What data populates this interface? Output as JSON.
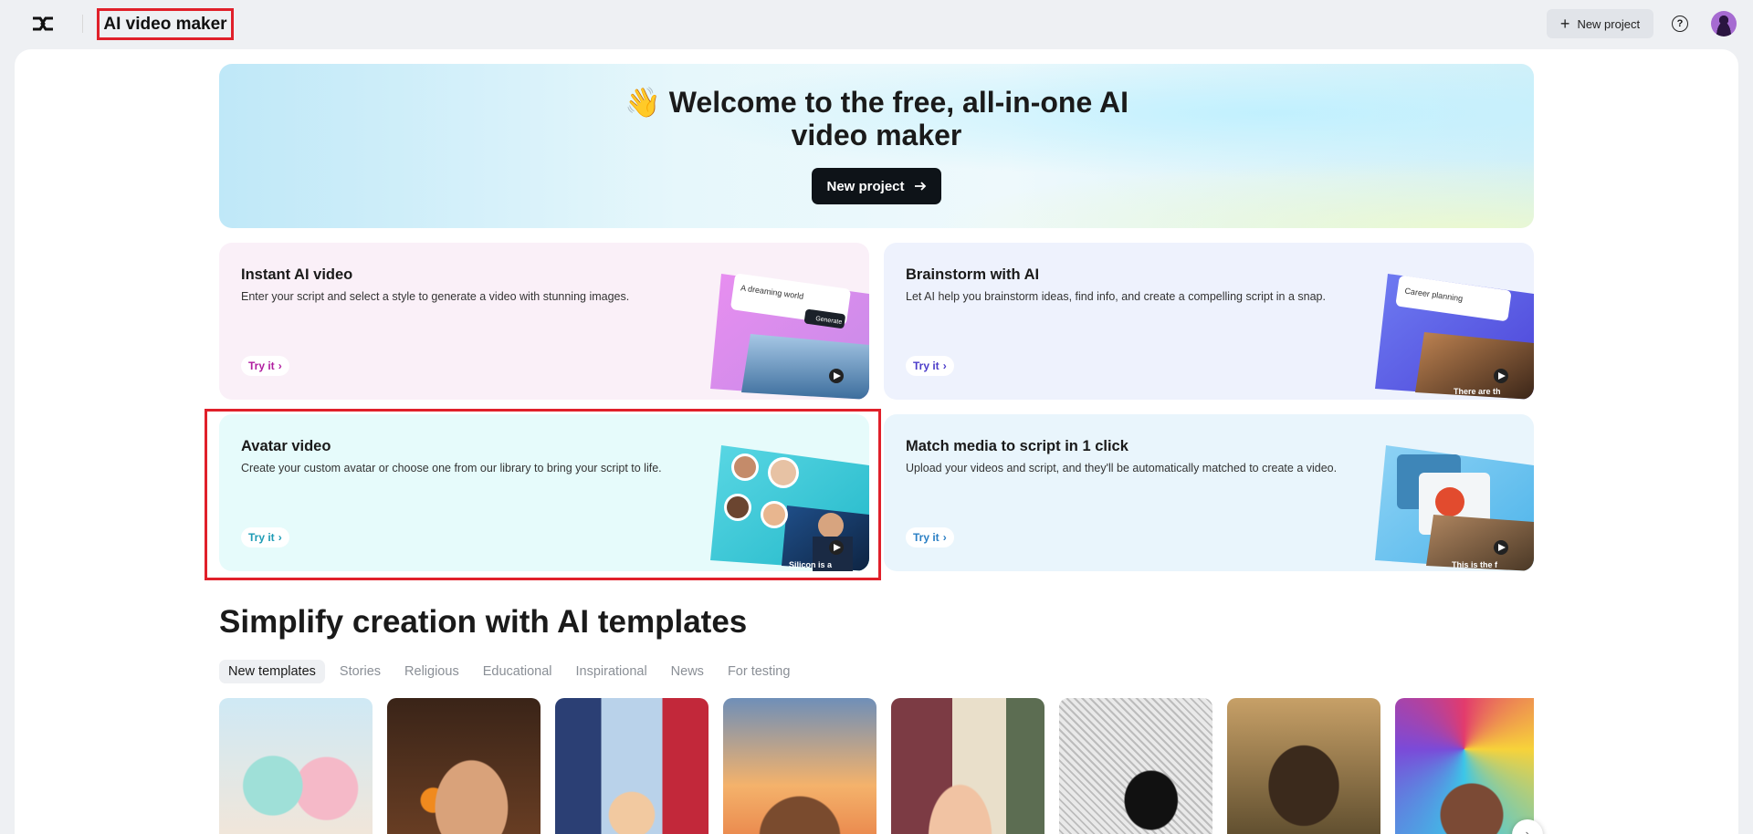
{
  "topbar": {
    "app_title": "AI video maker",
    "new_project_label": "New project",
    "help_icon": "?"
  },
  "hero": {
    "title_line1": "👋 Welcome to the free, all-in-one AI",
    "title_line2": "video maker",
    "button_label": "New project"
  },
  "cards": [
    {
      "title": "Instant AI video",
      "description": "Enter your script and select a style to generate a video with stunning images.",
      "try_label": "Try it",
      "art_prompt": "A dreaming world",
      "art_button": "Generate"
    },
    {
      "title": "Brainstorm with AI",
      "description": "Let AI help you brainstorm ideas, find info, and create a compelling script in a snap.",
      "try_label": "Try it",
      "art_prompt": "Career planning",
      "art_caption": "There are th"
    },
    {
      "title": "Avatar video",
      "description": "Create your custom avatar or choose one from our library to bring your script to life.",
      "try_label": "Try it",
      "art_caption": "Silicon is a"
    },
    {
      "title": "Match media to script in 1 click",
      "description": "Upload your videos and script, and they'll be automatically matched to create a video.",
      "try_label": "Try it",
      "art_caption": "This is the f"
    }
  ],
  "templates": {
    "section_title": "Simplify creation with AI templates",
    "tabs": [
      "New templates",
      "Stories",
      "Religious",
      "Educational",
      "Inspirational",
      "News",
      "For testing"
    ],
    "active_tab": "New templates",
    "next_icon": "chevron-right-icon"
  },
  "colors": {
    "highlight": "#e0202a",
    "hero_button": "#0e1318",
    "card1_accent": "#b01ea0",
    "card2_accent": "#4b3cc9",
    "card3_accent": "#1e9bb5",
    "card4_accent": "#2a7fc4"
  }
}
